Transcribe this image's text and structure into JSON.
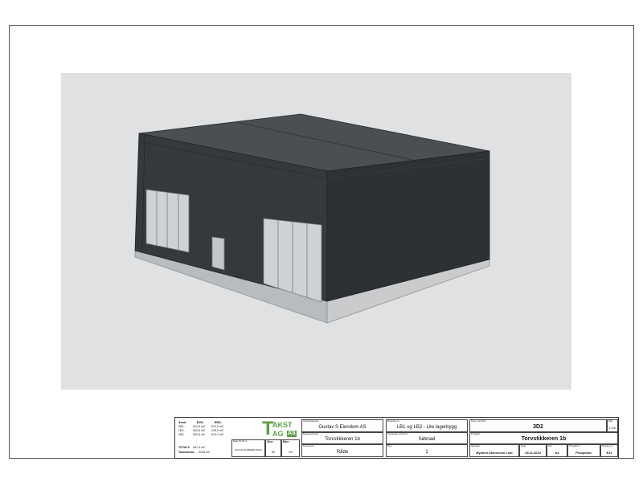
{
  "area_table": {
    "headers": [
      "Areal:",
      "BYA:",
      "BRA:"
    ],
    "rows": [
      {
        "name": "SB1:",
        "bya": "612,6 m2",
        "bra": "574,2 m2"
      },
      {
        "name": "LB1:",
        "bya": "262,6 m2",
        "bra": "249,0 m2"
      },
      {
        "name": "LB2:",
        "bya": "262,6 m2",
        "bra": "514,2 m2"
      }
    ],
    "total_label": "TOTALT:",
    "total_value": "937,4 m2",
    "tomt_label": "Tomteareal:",
    "tomt_value": "3248 m2"
  },
  "small_block": {
    "label": "Dato ID ID nr",
    "note": "SGS ID NUMMER DATO",
    "gnr_label": "Gnr:",
    "gnr_value": "92",
    "bnr_label": "Bnr:",
    "bnr_value": "99"
  },
  "logo": {
    "letter_t": "T",
    "akst": "AKST",
    "ag": "AG",
    "as": "AS",
    "color": "#5aa047"
  },
  "client": {
    "label": "Oppdragsgiver",
    "value": "Gustav S Eiendom AS"
  },
  "address": {
    "label": "Byggeadresse",
    "value": "Torvstikkeren 1b"
  },
  "kommune": {
    "label": "Kommune",
    "value": "Råde"
  },
  "building": {
    "label": "Bygning nr",
    "value": "LB1 og LB2 - Lite lagerbygg"
  },
  "purpose": {
    "label": "Tegningens formål",
    "value": "Søknad"
  },
  "revision": {
    "label": "Rev.",
    "value": "1"
  },
  "drawing_title": {
    "label": "Tegn. innhold",
    "value": "3D2"
  },
  "scale": {
    "label": "Mål",
    "value": "1:100"
  },
  "project": {
    "label": "Prosjekt",
    "value": "Torvstikkeren 1b"
  },
  "sign": {
    "label": "Signatur",
    "value": "Øystein Akersveen Lied"
  },
  "date": {
    "label": "Dato",
    "value": "25.11.2024"
  },
  "format": {
    "label": "Ark",
    "value": "A3"
  },
  "phase": {
    "label": "Prosjekt nr",
    "value": "Prosjektor."
  },
  "sheet_no": {
    "label": "Tegning nr",
    "value": "E12"
  }
}
